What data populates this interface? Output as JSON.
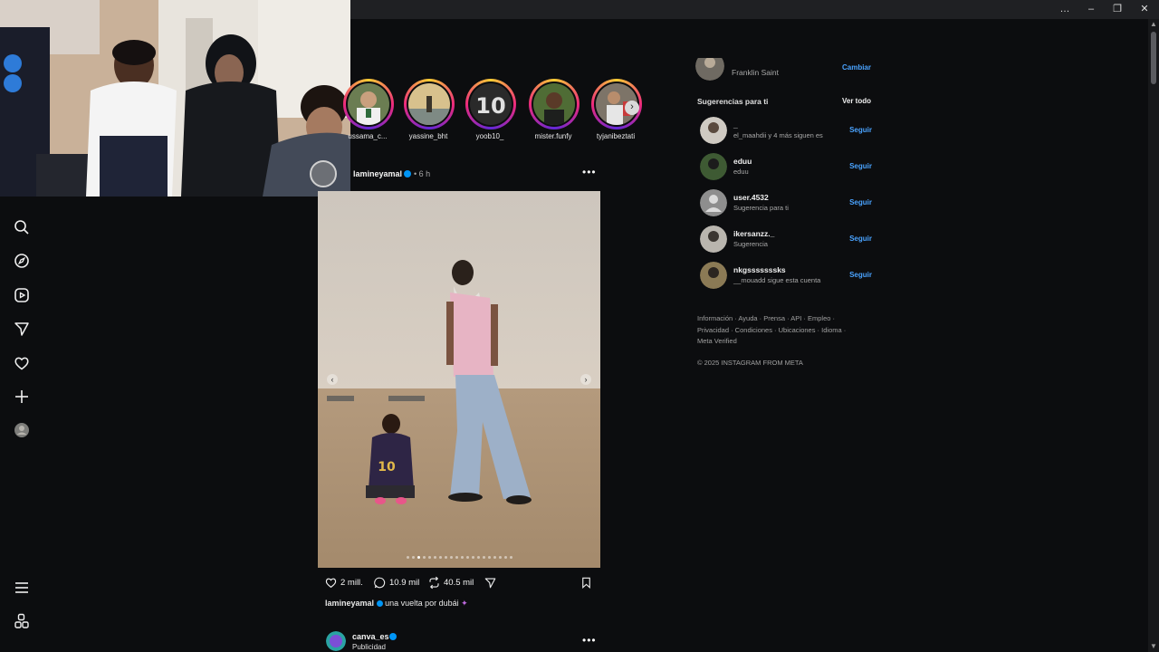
{
  "window": {
    "minimize": "–",
    "restore": "❐",
    "close": "✕",
    "more": "…"
  },
  "nav": {
    "icons": [
      "search-icon",
      "explore-icon",
      "reels-icon",
      "messages-icon",
      "notifications-icon",
      "create-icon",
      "profile-avatar",
      "menu-icon",
      "more-apps-icon"
    ]
  },
  "stories": [
    {
      "name": "ussama_c..."
    },
    {
      "name": "yassine_bht"
    },
    {
      "name": "yoob10_"
    },
    {
      "name": "mister.funfy"
    },
    {
      "name": "tyjanibeztati"
    }
  ],
  "post": {
    "username": "lamineyamal",
    "time": "• 6 h",
    "likes": "2 mill.",
    "comments": "10.9 mil",
    "reposts": "40.5 mil",
    "caption_user": "lamineyamal",
    "caption_text": "una vuelta por dubái",
    "carousel_total": 20,
    "carousel_active": 3
  },
  "next_post": {
    "username": "canva_es",
    "label": "Publicidad"
  },
  "sidebar": {
    "current_user_subtitle": "Franklin Saint",
    "switch_label": "Cambiar",
    "suggestions_title": "Sugerencias para ti",
    "see_all": "Ver todo",
    "follow_label": "Seguir",
    "suggestions": [
      {
        "name": "_",
        "sub": "el_maahdii y 4 más siguen es"
      },
      {
        "name": "eduu",
        "sub": "eduu"
      },
      {
        "name": "user.4532",
        "sub": "Sugerencia para ti"
      },
      {
        "name": "ikersanzz._",
        "sub": "Sugerencia"
      },
      {
        "name": "nkgsssssssks",
        "sub": "__mouadd sigue esta cuenta"
      }
    ],
    "footer_line1": "Información · Ayuda · Prensa · API · Empleo ·",
    "footer_line2": "Privacidad · Condiciones · Ubicaciones · Idioma ·",
    "footer_line3": "Meta Verified",
    "copyright": "© 2025 INSTAGRAM FROM META"
  },
  "colors": {
    "accent": "#4aa3ff",
    "background": "#0c0d0f",
    "verified": "#0095f6"
  }
}
